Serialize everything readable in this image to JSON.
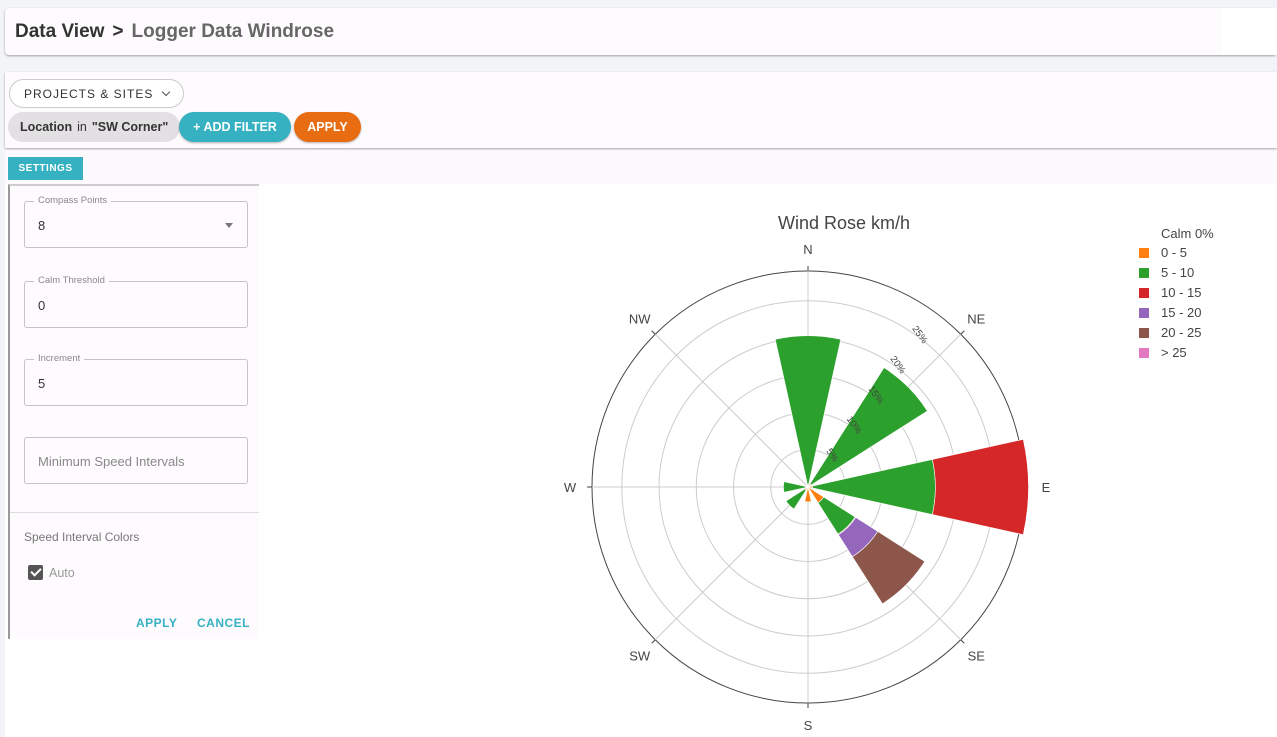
{
  "header": {
    "root": "Data View",
    "separator": ">",
    "current": "Logger Data Windrose"
  },
  "filters": {
    "projects_label": "PROJECTS & SITES",
    "chip_field": "Location",
    "chip_op": "in",
    "chip_value": "\"SW Corner\"",
    "add_filter_label": "+ ADD FILTER",
    "apply_label": "APPLY"
  },
  "settings": {
    "tab_label": "SETTINGS",
    "compass_points": {
      "label": "Compass Points",
      "value": "8"
    },
    "calm_threshold": {
      "label": "Calm Threshold",
      "value": "0"
    },
    "increment": {
      "label": "Increment",
      "value": "5"
    },
    "min_speed": {
      "placeholder": "Minimum Speed Intervals"
    },
    "colors_label": "Speed Interval Colors",
    "auto_label": "Auto",
    "apply_label": "APPLY",
    "cancel_label": "CANCEL"
  },
  "colors": {
    "accent": "#35b1c2",
    "apply_orange": "#e76c12"
  },
  "chart_data": {
    "type": "windrose",
    "title": "Wind Rose km/h",
    "calm_label": "Calm 0%",
    "radial_ticks": [
      "5%",
      "10%",
      "15%",
      "20%",
      "25%"
    ],
    "radial_max": 29,
    "directions": [
      "N",
      "NE",
      "E",
      "SE",
      "S",
      "SW",
      "W",
      "NW"
    ],
    "series": [
      {
        "name": "0 - 5",
        "color": "#ff7f0e",
        "values": [
          0.3,
          0.5,
          0.6,
          2.5,
          2.0,
          0.5,
          0.3,
          0.3
        ]
      },
      {
        "name": "5 - 10",
        "color": "#2ca02c",
        "values": [
          20.0,
          18.5,
          16.5,
          5.0,
          0.1,
          3.0,
          3.0,
          0.1
        ]
      },
      {
        "name": "10 - 15",
        "color": "#d62728",
        "values": [
          0,
          0,
          12.5,
          0.1,
          0,
          0,
          0,
          0
        ]
      },
      {
        "name": "15 - 20",
        "color": "#9467bd",
        "values": [
          0,
          0,
          0,
          3.5,
          0,
          0,
          0,
          0
        ]
      },
      {
        "name": "20 - 25",
        "color": "#8c564b",
        "values": [
          0,
          0,
          0,
          7.5,
          0,
          0,
          0,
          0
        ]
      },
      {
        "name": "> 25",
        "color": "#e377c2",
        "values": [
          0,
          0,
          0,
          0,
          0,
          0,
          0,
          0
        ]
      }
    ]
  }
}
